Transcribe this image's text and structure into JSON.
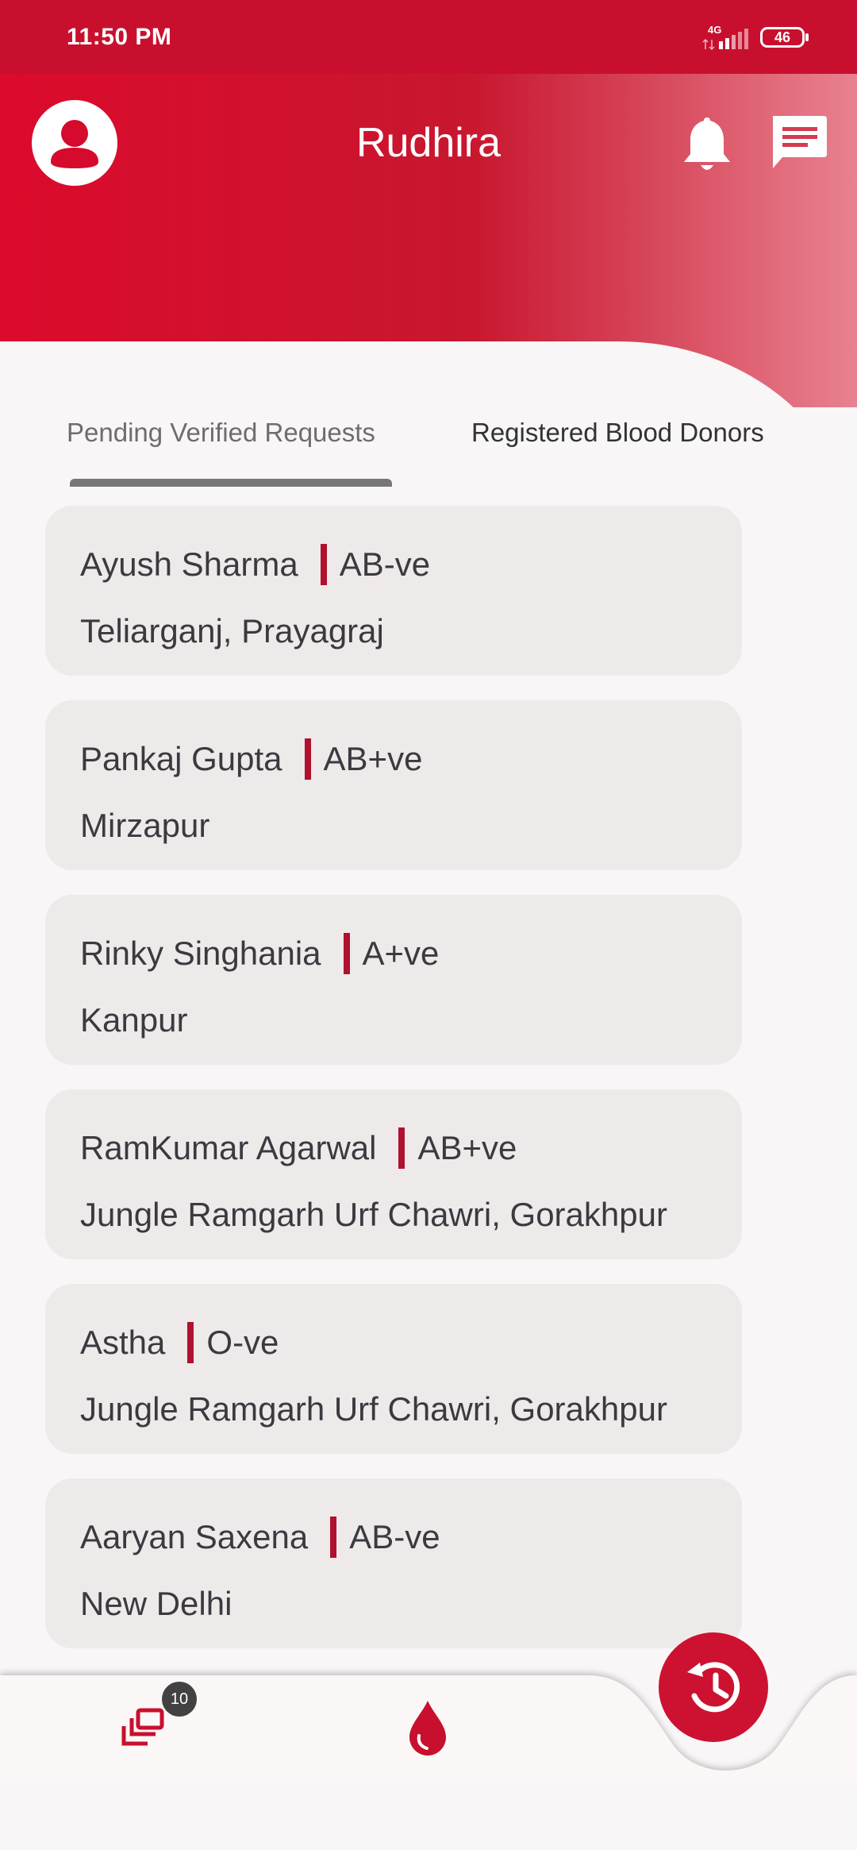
{
  "status_bar": {
    "time": "11:50 PM",
    "network": "4G",
    "battery": "46"
  },
  "header": {
    "title": "Rudhira"
  },
  "tabs": [
    {
      "label": "Pending Verified Requests",
      "selected": true
    },
    {
      "label": "Registered Blood Donors",
      "selected": false
    }
  ],
  "requests": [
    {
      "name": "Ayush Sharma",
      "blood_group": "AB-ve",
      "location": "Teliarganj, Prayagraj"
    },
    {
      "name": "Pankaj Gupta",
      "blood_group": "AB+ve",
      "location": "Mirzapur"
    },
    {
      "name": "Rinky Singhania",
      "blood_group": "A+ve",
      "location": "Kanpur"
    },
    {
      "name": "RamKumar Agarwal",
      "blood_group": "AB+ve",
      "location": "Jungle Ramgarh Urf Chawri, Gorakhpur"
    },
    {
      "name": "Astha ",
      "blood_group": "O-ve",
      "location": "Jungle Ramgarh Urf Chawri, Gorakhpur"
    },
    {
      "name": "Aaryan Saxena",
      "blood_group": "AB-ve",
      "location": "New Delhi"
    }
  ],
  "bottom_nav": {
    "requests_badge": "10"
  },
  "colors": {
    "primary": "#c8102e",
    "card": "#efeaea",
    "accent_bar": "#b0112f"
  },
  "icons": [
    "profile-avatar-icon",
    "bell-icon",
    "chat-icon",
    "stack-icon",
    "blood-drop-icon",
    "history-icon"
  ]
}
